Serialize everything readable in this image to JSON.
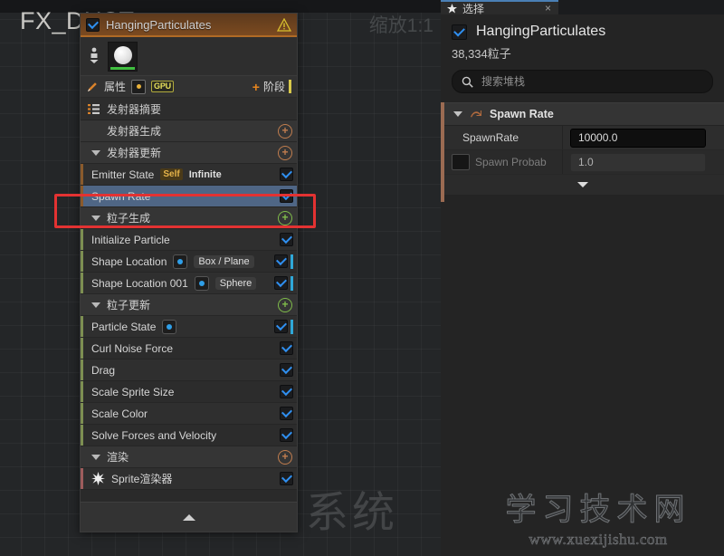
{
  "viewport": {
    "asset_title": "FX_DUST",
    "zoom_label": "缩放1:1",
    "ghost_label": "系统"
  },
  "watermark": {
    "brand": "学习技术网",
    "url": "www.xuexijishu.com"
  },
  "emitter_panel": {
    "title": "HangingParticulates",
    "enabled_checkbox": true,
    "warning_icon": "warning-triangle-icon",
    "attributes_row": {
      "pencil_icon": "pencil-icon",
      "label": "属性",
      "dot_badge": "orange-dot-badge",
      "gpu_badge": "GPU",
      "plus": "+",
      "stage_label": "阶段"
    },
    "summary_row": {
      "icon": "list-icon",
      "label": "发射器摘要"
    },
    "sections": [
      {
        "label": "发射器生成",
        "caret": false,
        "plus_color": "#c07d4e",
        "strip": "orange",
        "modules": []
      },
      {
        "label": "发射器更新",
        "caret": true,
        "plus_color": "#c07d4e",
        "strip": "orange",
        "modules": [
          {
            "label": "Emitter State",
            "tags": [
              "Self",
              "Infinite"
            ],
            "checked": true,
            "selected": false
          },
          {
            "label": "Spawn Rate",
            "tags": [],
            "checked": true,
            "selected": true
          }
        ]
      },
      {
        "label": "粒子生成",
        "caret": true,
        "plus_color": "#7fbb4a",
        "strip": "green",
        "modules": [
          {
            "label": "Initialize Particle",
            "tags": [],
            "checked": true,
            "selected": false
          },
          {
            "label": "Shape Location",
            "pill": "Box / Plane",
            "dot": true,
            "checked": true,
            "selected": false,
            "cyan": true
          },
          {
            "label": "Shape Location 001",
            "pill": "Sphere",
            "dot": true,
            "checked": true,
            "selected": false,
            "cyan": true
          }
        ]
      },
      {
        "label": "粒子更新",
        "caret": true,
        "plus_color": "#7fbb4a",
        "strip": "green",
        "modules": [
          {
            "label": "Particle State",
            "dot": true,
            "checked": true,
            "selected": false,
            "cyan": true
          },
          {
            "label": "Curl Noise Force",
            "checked": true,
            "selected": false
          },
          {
            "label": "Drag",
            "checked": true,
            "selected": false
          },
          {
            "label": "Scale Sprite Size",
            "checked": true,
            "selected": false
          },
          {
            "label": "Scale Color",
            "checked": true,
            "selected": false
          },
          {
            "label": "Solve Forces and Velocity",
            "checked": true,
            "selected": false
          }
        ]
      },
      {
        "label": "渲染",
        "caret": true,
        "plus_color": "#c07d4e",
        "strip": "red",
        "modules": [
          {
            "label": "Sprite渲染器",
            "star": true,
            "checked": true,
            "selected": false
          }
        ]
      }
    ],
    "collapse_icon": "chevron-up-icon"
  },
  "details_panel": {
    "tab": {
      "icon": "star-selection-icon",
      "label": "选择",
      "close": "×"
    },
    "header": {
      "checkbox": true,
      "title": "HangingParticulates",
      "particle_count": "38,334粒子"
    },
    "search": {
      "icon": "search-icon",
      "placeholder": "搜索堆栈",
      "value": ""
    },
    "group": {
      "caret": true,
      "icon": "spawn-rate-module-icon",
      "label": "Spawn Rate"
    },
    "properties": [
      {
        "name": "SpawnRate",
        "value": "10000.0",
        "dim": false,
        "swatch": false
      },
      {
        "name": "Spawn Probab",
        "value": "1.0",
        "dim": true,
        "swatch": true
      }
    ],
    "expand_icon": "chevron-down-icon"
  }
}
